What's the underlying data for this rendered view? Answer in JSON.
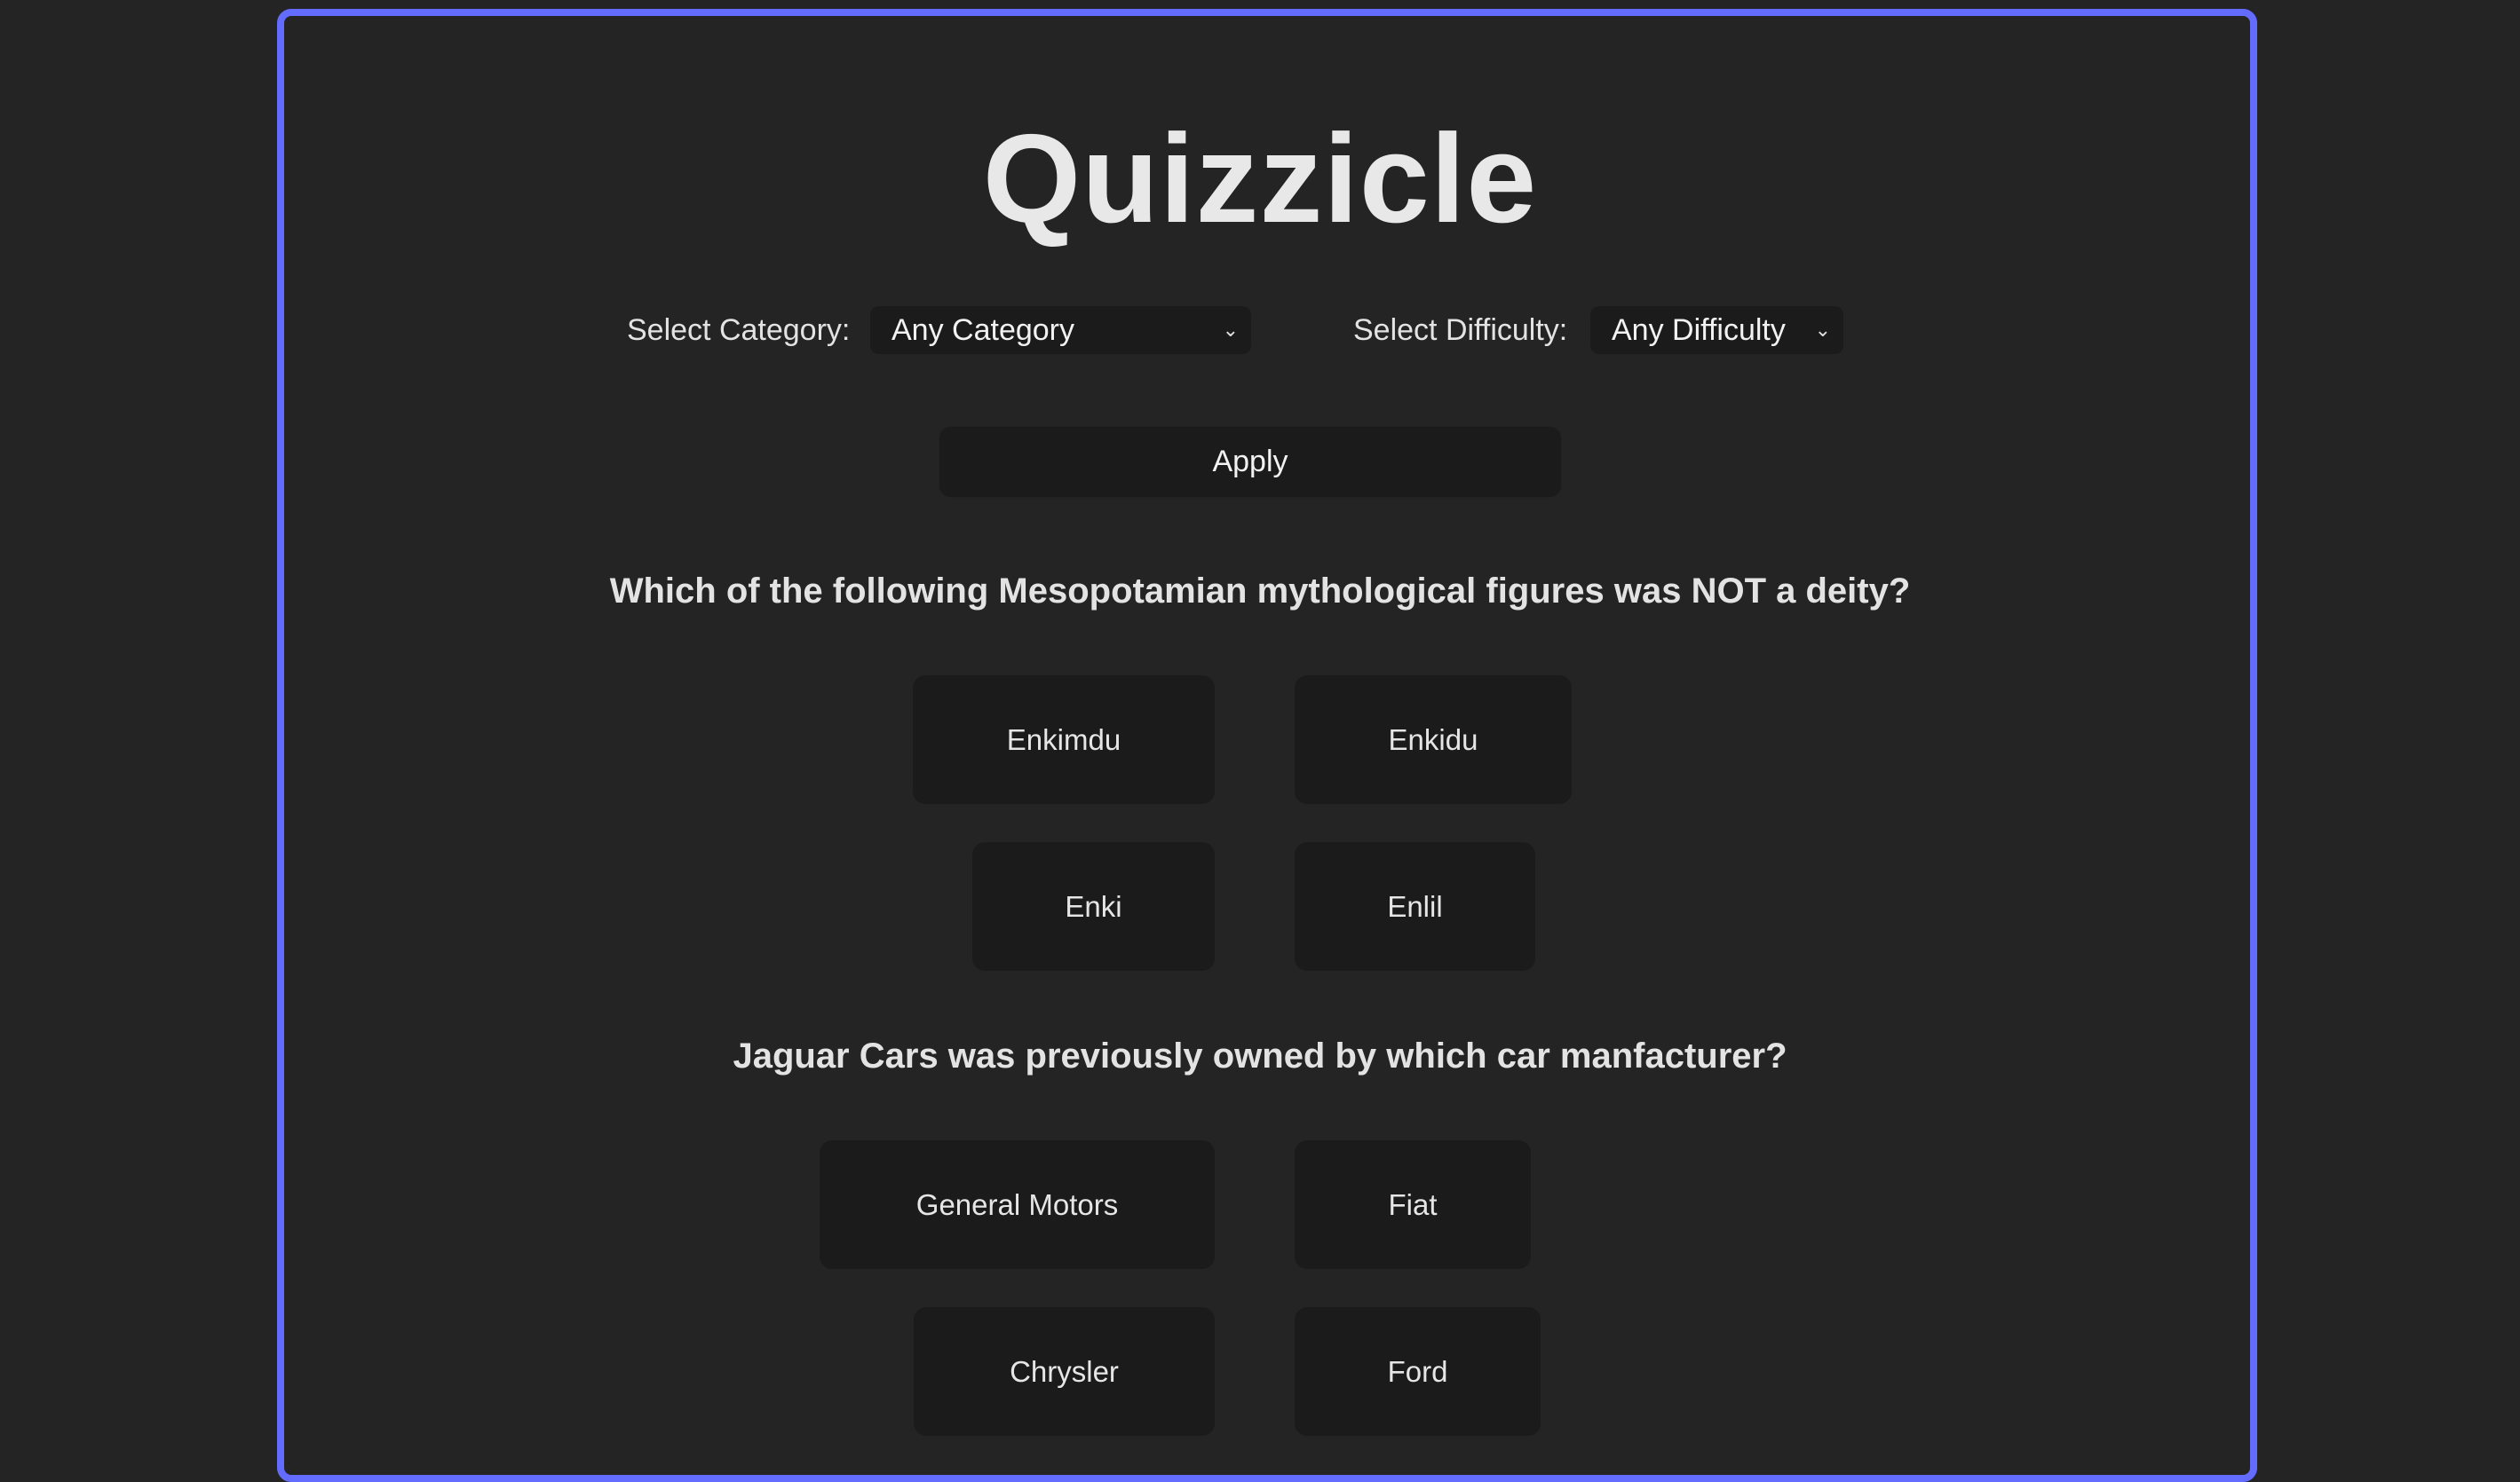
{
  "app": {
    "title": "Quizzicle"
  },
  "filters": {
    "category_label": "Select Category:",
    "category_value": "Any Category",
    "difficulty_label": "Select Difficulty:",
    "difficulty_value": "Any Difficulty",
    "apply_label": "Apply"
  },
  "questions": [
    {
      "text": "Which of the following Mesopotamian mythological figures was NOT a deity?",
      "answers": [
        "Enkimdu",
        "Enkidu",
        "Enki",
        "Enlil"
      ]
    },
    {
      "text": "Jaguar Cars was previously owned by which car manfacturer?",
      "answers": [
        "General Motors",
        "Fiat",
        "Chrysler",
        "Ford"
      ]
    }
  ],
  "icons": {
    "dropdown": "chevron-down-icon"
  },
  "colors": {
    "accent": "#646cff",
    "background": "#242424",
    "surface": "#1b1b1b",
    "text": "#e6e6e6"
  }
}
